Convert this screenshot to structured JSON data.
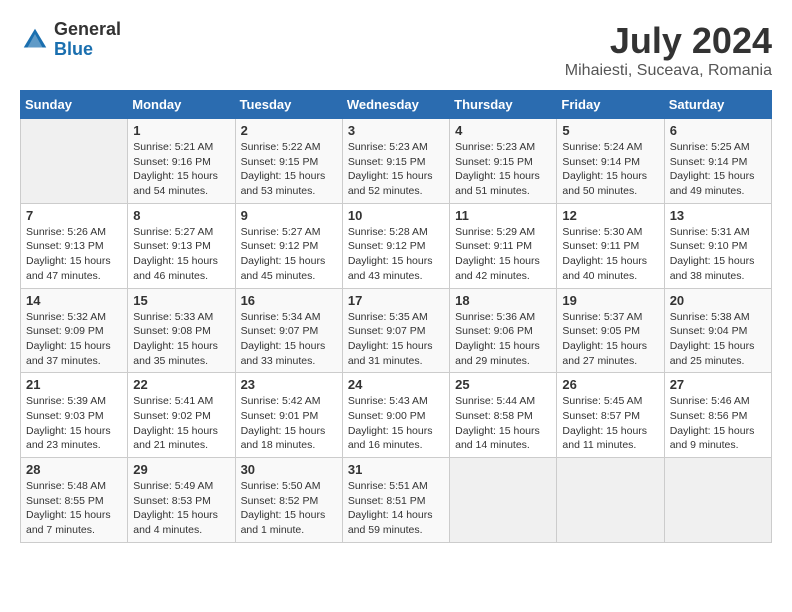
{
  "logo": {
    "general": "General",
    "blue": "Blue"
  },
  "title": "July 2024",
  "location": "Mihaiesti, Suceava, Romania",
  "days_of_week": [
    "Sunday",
    "Monday",
    "Tuesday",
    "Wednesday",
    "Thursday",
    "Friday",
    "Saturday"
  ],
  "weeks": [
    [
      {
        "day": "",
        "info": ""
      },
      {
        "day": "1",
        "info": "Sunrise: 5:21 AM\nSunset: 9:16 PM\nDaylight: 15 hours\nand 54 minutes."
      },
      {
        "day": "2",
        "info": "Sunrise: 5:22 AM\nSunset: 9:15 PM\nDaylight: 15 hours\nand 53 minutes."
      },
      {
        "day": "3",
        "info": "Sunrise: 5:23 AM\nSunset: 9:15 PM\nDaylight: 15 hours\nand 52 minutes."
      },
      {
        "day": "4",
        "info": "Sunrise: 5:23 AM\nSunset: 9:15 PM\nDaylight: 15 hours\nand 51 minutes."
      },
      {
        "day": "5",
        "info": "Sunrise: 5:24 AM\nSunset: 9:14 PM\nDaylight: 15 hours\nand 50 minutes."
      },
      {
        "day": "6",
        "info": "Sunrise: 5:25 AM\nSunset: 9:14 PM\nDaylight: 15 hours\nand 49 minutes."
      }
    ],
    [
      {
        "day": "7",
        "info": "Sunrise: 5:26 AM\nSunset: 9:13 PM\nDaylight: 15 hours\nand 47 minutes."
      },
      {
        "day": "8",
        "info": "Sunrise: 5:27 AM\nSunset: 9:13 PM\nDaylight: 15 hours\nand 46 minutes."
      },
      {
        "day": "9",
        "info": "Sunrise: 5:27 AM\nSunset: 9:12 PM\nDaylight: 15 hours\nand 45 minutes."
      },
      {
        "day": "10",
        "info": "Sunrise: 5:28 AM\nSunset: 9:12 PM\nDaylight: 15 hours\nand 43 minutes."
      },
      {
        "day": "11",
        "info": "Sunrise: 5:29 AM\nSunset: 9:11 PM\nDaylight: 15 hours\nand 42 minutes."
      },
      {
        "day": "12",
        "info": "Sunrise: 5:30 AM\nSunset: 9:11 PM\nDaylight: 15 hours\nand 40 minutes."
      },
      {
        "day": "13",
        "info": "Sunrise: 5:31 AM\nSunset: 9:10 PM\nDaylight: 15 hours\nand 38 minutes."
      }
    ],
    [
      {
        "day": "14",
        "info": "Sunrise: 5:32 AM\nSunset: 9:09 PM\nDaylight: 15 hours\nand 37 minutes."
      },
      {
        "day": "15",
        "info": "Sunrise: 5:33 AM\nSunset: 9:08 PM\nDaylight: 15 hours\nand 35 minutes."
      },
      {
        "day": "16",
        "info": "Sunrise: 5:34 AM\nSunset: 9:07 PM\nDaylight: 15 hours\nand 33 minutes."
      },
      {
        "day": "17",
        "info": "Sunrise: 5:35 AM\nSunset: 9:07 PM\nDaylight: 15 hours\nand 31 minutes."
      },
      {
        "day": "18",
        "info": "Sunrise: 5:36 AM\nSunset: 9:06 PM\nDaylight: 15 hours\nand 29 minutes."
      },
      {
        "day": "19",
        "info": "Sunrise: 5:37 AM\nSunset: 9:05 PM\nDaylight: 15 hours\nand 27 minutes."
      },
      {
        "day": "20",
        "info": "Sunrise: 5:38 AM\nSunset: 9:04 PM\nDaylight: 15 hours\nand 25 minutes."
      }
    ],
    [
      {
        "day": "21",
        "info": "Sunrise: 5:39 AM\nSunset: 9:03 PM\nDaylight: 15 hours\nand 23 minutes."
      },
      {
        "day": "22",
        "info": "Sunrise: 5:41 AM\nSunset: 9:02 PM\nDaylight: 15 hours\nand 21 minutes."
      },
      {
        "day": "23",
        "info": "Sunrise: 5:42 AM\nSunset: 9:01 PM\nDaylight: 15 hours\nand 18 minutes."
      },
      {
        "day": "24",
        "info": "Sunrise: 5:43 AM\nSunset: 9:00 PM\nDaylight: 15 hours\nand 16 minutes."
      },
      {
        "day": "25",
        "info": "Sunrise: 5:44 AM\nSunset: 8:58 PM\nDaylight: 15 hours\nand 14 minutes."
      },
      {
        "day": "26",
        "info": "Sunrise: 5:45 AM\nSunset: 8:57 PM\nDaylight: 15 hours\nand 11 minutes."
      },
      {
        "day": "27",
        "info": "Sunrise: 5:46 AM\nSunset: 8:56 PM\nDaylight: 15 hours\nand 9 minutes."
      }
    ],
    [
      {
        "day": "28",
        "info": "Sunrise: 5:48 AM\nSunset: 8:55 PM\nDaylight: 15 hours\nand 7 minutes."
      },
      {
        "day": "29",
        "info": "Sunrise: 5:49 AM\nSunset: 8:53 PM\nDaylight: 15 hours\nand 4 minutes."
      },
      {
        "day": "30",
        "info": "Sunrise: 5:50 AM\nSunset: 8:52 PM\nDaylight: 15 hours\nand 1 minute."
      },
      {
        "day": "31",
        "info": "Sunrise: 5:51 AM\nSunset: 8:51 PM\nDaylight: 14 hours\nand 59 minutes."
      },
      {
        "day": "",
        "info": ""
      },
      {
        "day": "",
        "info": ""
      },
      {
        "day": "",
        "info": ""
      }
    ]
  ]
}
